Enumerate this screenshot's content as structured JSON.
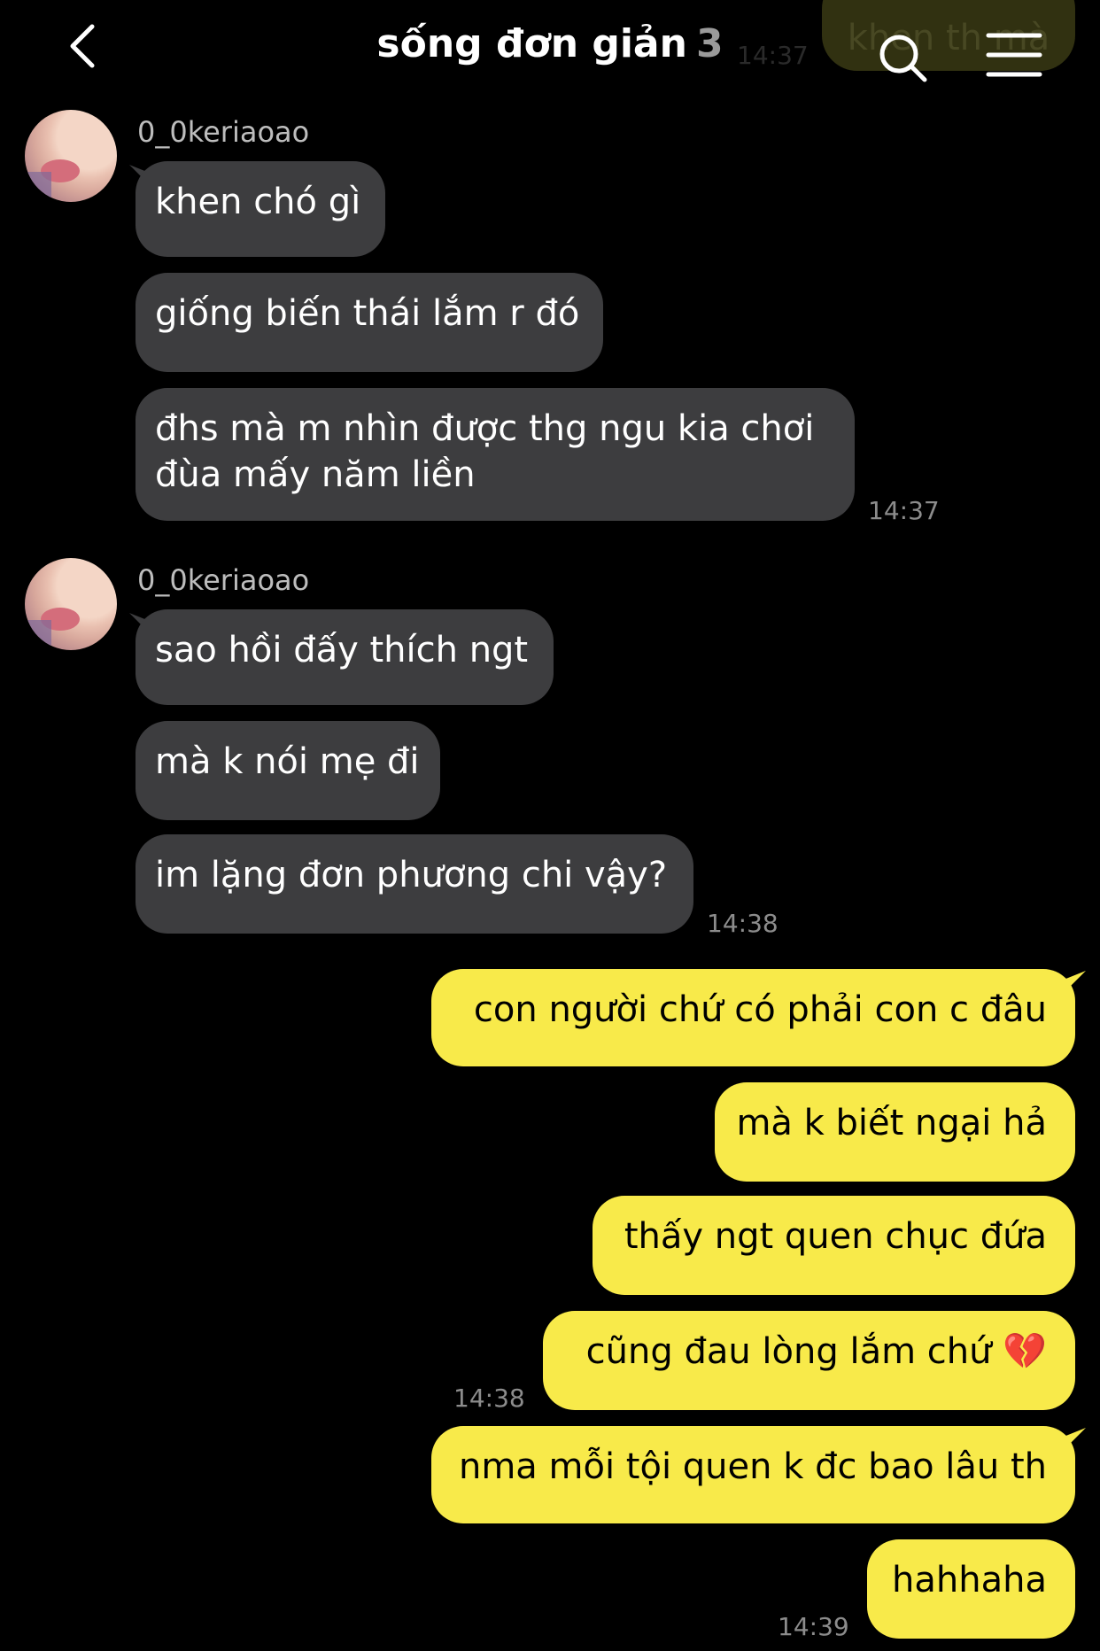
{
  "header": {
    "title": "sống đơn giản",
    "member_count": "3",
    "ghost_text": "khen th mà",
    "ghost_time": "14:37"
  },
  "messages": {
    "g1": {
      "username": "0_0keriaoao",
      "m1": "khen chó gì",
      "m2": "giống biến thái lắm r đó",
      "m3_line1": "đhs mà m nhìn được thg ngu kia chơi",
      "m3_line2": "đùa mấy năm liền",
      "time": "14:37"
    },
    "g2": {
      "username": "0_0keriaoao",
      "m1": "sao hồi đấy thích ngt",
      "m2": "mà k nói mẹ đi",
      "m3": "im lặng đơn phương chi vậy?",
      "time": "14:38"
    },
    "out1": {
      "m1": "con người chứ có phải con c đâu",
      "m2": "mà k biết ngại hả",
      "m3": "thấy ngt quen chục đứa",
      "m4": "cũng đau lòng lắm chứ 💔",
      "time": "14:38"
    },
    "out2": {
      "m1": "nma mỗi tội quen k đc bao lâu th",
      "m2": "hahhaha",
      "time": "14:39"
    }
  },
  "colors": {
    "incoming_bubble": "#3d3d3f",
    "outgoing_bubble": "#f8ea4a",
    "background": "#000000"
  },
  "icons": [
    "back-icon",
    "search-icon",
    "menu-icon"
  ]
}
